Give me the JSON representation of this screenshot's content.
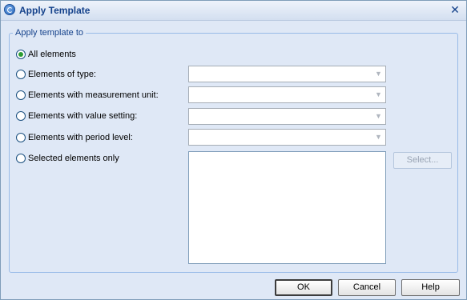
{
  "window": {
    "title": "Apply Template"
  },
  "group": {
    "legend": "Apply template to"
  },
  "options": [
    {
      "label": "All elements",
      "checked": true
    },
    {
      "label": "Elements of type:",
      "checked": false
    },
    {
      "label": "Elements with measurement unit:",
      "checked": false
    },
    {
      "label": "Elements with value setting:",
      "checked": false
    },
    {
      "label": "Elements with period level:",
      "checked": false
    },
    {
      "label": "Selected elements only",
      "checked": false
    }
  ],
  "combos": [
    {
      "value": ""
    },
    {
      "value": ""
    },
    {
      "value": ""
    },
    {
      "value": ""
    }
  ],
  "select_button": {
    "label": "Select..."
  },
  "footer": {
    "ok_label": "OK",
    "cancel_label": "Cancel",
    "help_label": "Help"
  },
  "icons": {
    "app": "app-logo-icon",
    "close": "close-icon",
    "dropdown": "chevron-down-icon"
  }
}
